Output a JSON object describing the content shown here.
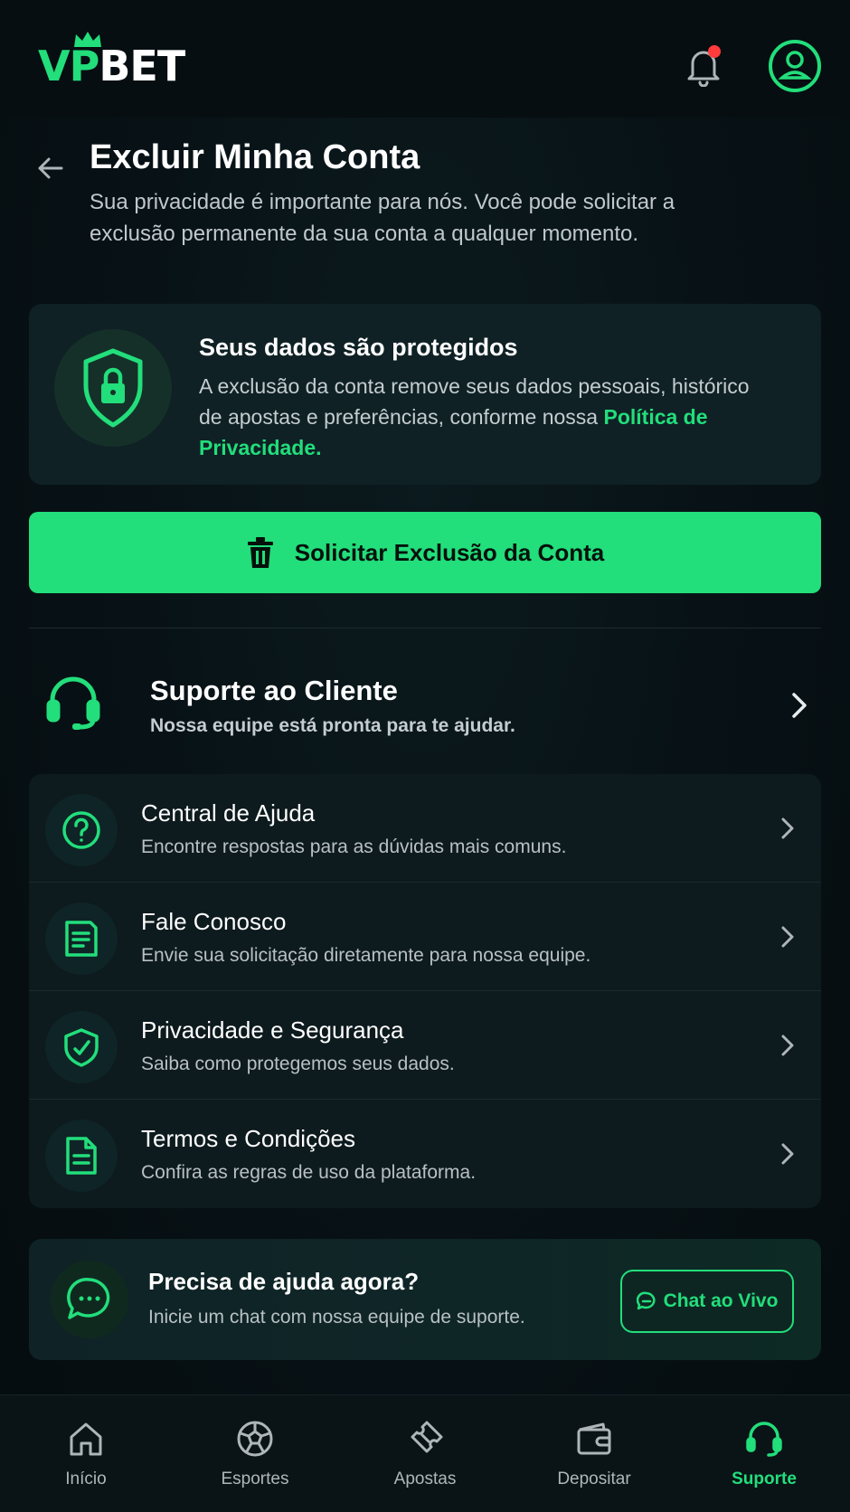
{
  "header": {
    "logo_vp": "VP",
    "logo_bet": "BET",
    "brand_color": "#22de7b",
    "notification_dot_color": "#ff3b3b"
  },
  "page": {
    "title": "Excluir Minha Conta",
    "subtitle": "Sua privacidade é importante para nós. Você pode solicitar a exclusão permanente da sua conta a qualquer momento."
  },
  "protect_card": {
    "title": "Seus dados são protegidos",
    "text": "A exclusão da conta remove seus dados pessoais, histórico de apostas e preferências, conforme nossa ",
    "link": "Política de Privacidade."
  },
  "delete_button": {
    "label": "Solicitar Exclusão da Conta"
  },
  "support": {
    "title": "Suporte ao Cliente",
    "subtitle": "Nossa equipe está pronta para te ajudar.",
    "items": [
      {
        "title": "Central de Ajuda",
        "subtitle": "Encontre respostas para as dúvidas mais comuns.",
        "icon": "question-circle-icon"
      },
      {
        "title": "Fale Conosco",
        "subtitle": "Envie sua solicitação diretamente para nossa equipe.",
        "icon": "form-document-icon"
      },
      {
        "title": "Privacidade e Segurança",
        "subtitle": "Saiba como protegemos seus dados.",
        "icon": "shield-check-icon"
      },
      {
        "title": "Termos e Condições",
        "subtitle": "Confira as regras de uso da plataforma.",
        "icon": "document-icon"
      }
    ]
  },
  "help_card": {
    "title": "Precisa de ajuda agora?",
    "subtitle": "Inicie um chat com nossa equipe de suporte.",
    "button": "Chat ao Vivo"
  },
  "bottom_nav": {
    "items": [
      {
        "label": "Início",
        "icon": "home-icon"
      },
      {
        "label": "Esportes",
        "icon": "soccer-ball-icon"
      },
      {
        "label": "Apostas",
        "icon": "ticket-icon"
      },
      {
        "label": "Depositar",
        "icon": "wallet-icon"
      },
      {
        "label": "Suporte",
        "icon": "headset-icon",
        "active": true
      }
    ]
  }
}
